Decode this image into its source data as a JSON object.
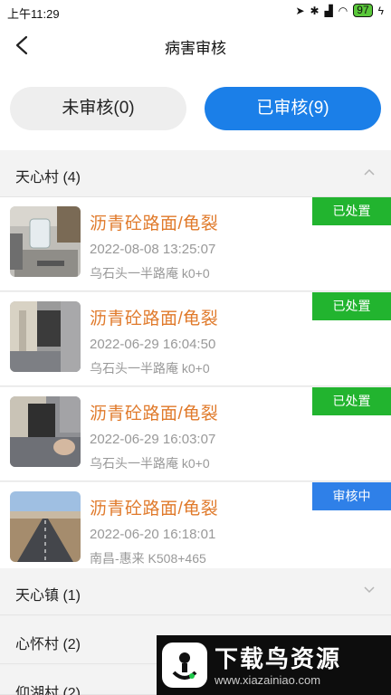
{
  "status_bar": {
    "time": "上午11:29",
    "battery": "97"
  },
  "nav": {
    "title": "病害审核"
  },
  "tabs": {
    "pending": "未审核(0)",
    "reviewed": "已审核(9)"
  },
  "groups": [
    {
      "label": "天心村 (4)"
    },
    {
      "label": "天心镇 (1)"
    },
    {
      "label": "心怀村 (2)"
    },
    {
      "label": "仰湖村 (2)"
    }
  ],
  "records": [
    {
      "title": "沥青砼路面/龟裂",
      "time": "2022-08-08 13:25:07",
      "location": "乌石头一半路庵 k0+0",
      "status": "已处置",
      "status_color": "#22b42f"
    },
    {
      "title": "沥青砼路面/龟裂",
      "time": "2022-06-29 16:04:50",
      "location": "乌石头一半路庵 k0+0",
      "status": "已处置",
      "status_color": "#22b42f"
    },
    {
      "title": "沥青砼路面/龟裂",
      "time": "2022-06-29 16:03:07",
      "location": "乌石头一半路庵 k0+0",
      "status": "已处置",
      "status_color": "#22b42f"
    },
    {
      "title": "沥青砼路面/龟裂",
      "time": "2022-06-20 16:18:01",
      "location": "南昌-惠来 K508+465",
      "status": "审核中",
      "status_color": "#2f80e8"
    }
  ],
  "watermark": {
    "title": "下载鸟资源",
    "url": "www.xiazainiao.com"
  },
  "colors": {
    "accent": "#1b7fe8",
    "title_orange": "#e07a2b",
    "badge_green": "#22b42f",
    "badge_blue": "#2f80e8"
  }
}
